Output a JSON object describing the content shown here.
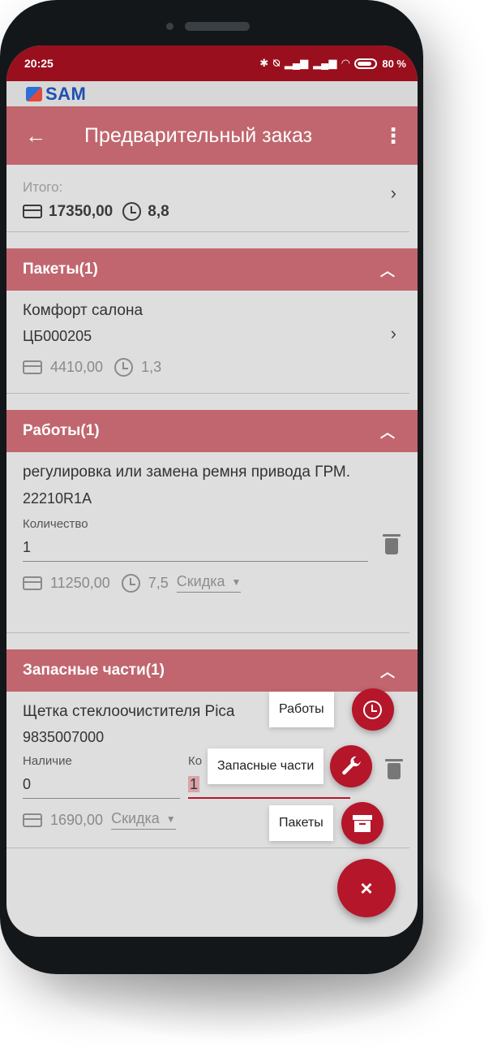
{
  "status": {
    "time": "20:25",
    "battery": "80 %"
  },
  "brand": {
    "name": "SAM"
  },
  "appbar": {
    "title": "Предварительный заказ"
  },
  "total": {
    "label": "Итого:",
    "amount": "17350,00",
    "hours": "8,8"
  },
  "packages": {
    "header": "Пакеты(1)",
    "items": [
      {
        "name": "Комфорт салона",
        "code": "ЦБ000205",
        "price": "4410,00",
        "hours": "1,3"
      }
    ]
  },
  "works": {
    "header": "Работы(1)",
    "items": [
      {
        "name": "регулировка или замена ремня привода ГРМ.",
        "code": "22210R1A",
        "quantity_label": "Количество",
        "quantity": "1",
        "price": "11250,00",
        "hours": "7,5",
        "discount_label": "Скидка"
      }
    ]
  },
  "parts": {
    "header": "Запасные части(1)",
    "items": [
      {
        "name": "Щетка стеклоочистителя Pica",
        "code": "9835007000",
        "availability_label": "Наличие",
        "availability": "0",
        "quantity_label_partial": "Ко",
        "quantity": "1",
        "price": "1690,00",
        "discount_label": "Скидка"
      }
    ]
  },
  "fab_menu": {
    "items": [
      {
        "label": "Работы",
        "icon": "clock-icon"
      },
      {
        "label": "Запасные части",
        "icon": "wrench-icon"
      },
      {
        "label": "Пакеты",
        "icon": "archive-icon"
      }
    ],
    "close_symbol": "×"
  }
}
